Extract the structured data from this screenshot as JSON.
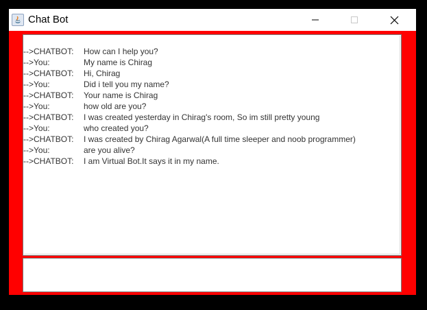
{
  "window": {
    "title": "Chat Bot",
    "background_color": "#ff0000",
    "controls": {
      "minimize": "minimize-icon",
      "maximize": "maximize-icon",
      "close": "close-icon"
    }
  },
  "chat": {
    "lines": [
      {
        "speaker": "-->CHATBOT:",
        "text": "How can I help you?"
      },
      {
        "speaker": "-->You:",
        "text": "My name is Chirag"
      },
      {
        "speaker": "-->CHATBOT:",
        "text": "Hi,  Chirag"
      },
      {
        "speaker": "-->You:",
        "text": "Did i tell you my name?"
      },
      {
        "speaker": "-->CHATBOT:",
        "text": "Your name is  Chirag"
      },
      {
        "speaker": "-->You:",
        "text": "how old are you?"
      },
      {
        "speaker": "-->CHATBOT:",
        "text": "I was created yesterday in Chirag's room, So im still pretty young"
      },
      {
        "speaker": "-->You:",
        "text": "who created you?"
      },
      {
        "speaker": "-->CHATBOT:",
        "text": "I was created by Chirag Agarwal(A full time sleeper and noob programmer)"
      },
      {
        "speaker": "-->You:",
        "text": "are you alive?"
      },
      {
        "speaker": "-->CHATBOT:",
        "text": "I am Virtual Bot.It says it in my name."
      }
    ]
  },
  "input": {
    "value": ""
  }
}
